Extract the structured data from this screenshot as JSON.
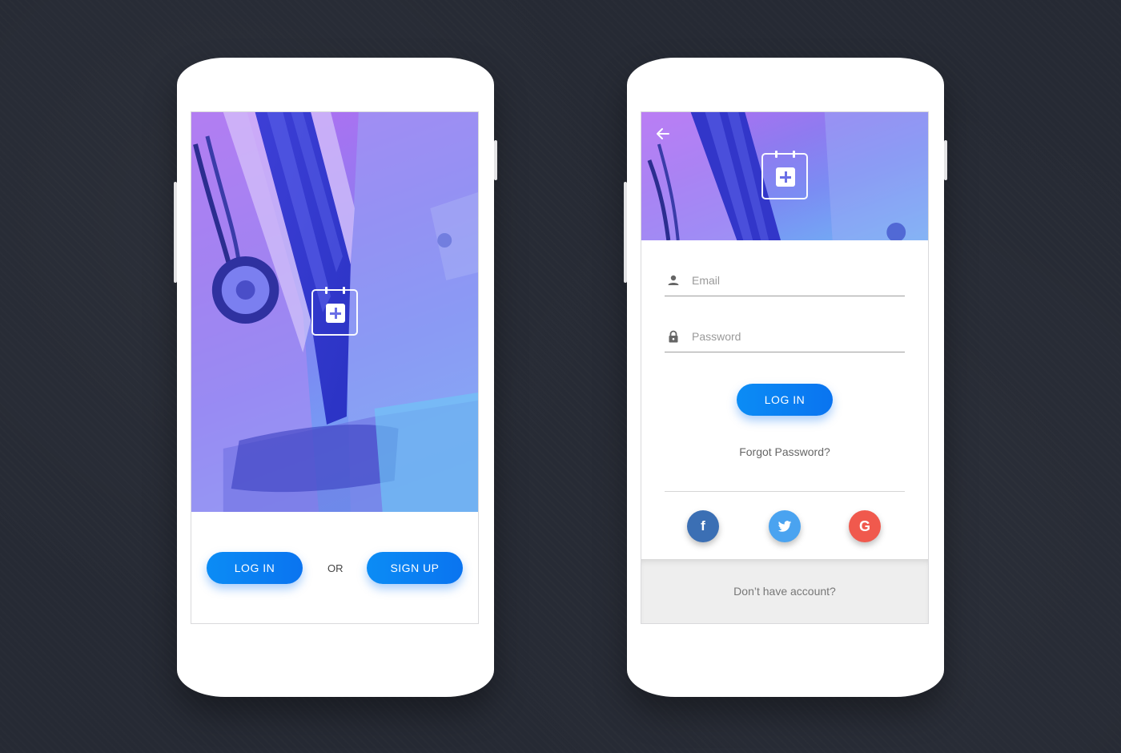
{
  "welcome_screen": {
    "login_label": "LOG IN",
    "or_label": "OR",
    "signup_label": "SIGN UP"
  },
  "login_screen": {
    "email": {
      "placeholder": "Email",
      "value": ""
    },
    "password": {
      "placeholder": "Password",
      "value": ""
    },
    "login_label": "LOG IN",
    "forgot_label": "Forgot Password?",
    "social": [
      {
        "name": "facebook",
        "glyph": "f",
        "color": "#3b6fb4"
      },
      {
        "name": "twitter",
        "glyph": "twitter-bird",
        "color": "#4aa3f0"
      },
      {
        "name": "google",
        "glyph": "G",
        "color": "#f0594d"
      }
    ],
    "footer_label": "Don’t have account?"
  },
  "colors": {
    "accent": "#0a7ef2",
    "background": "#262a34"
  }
}
